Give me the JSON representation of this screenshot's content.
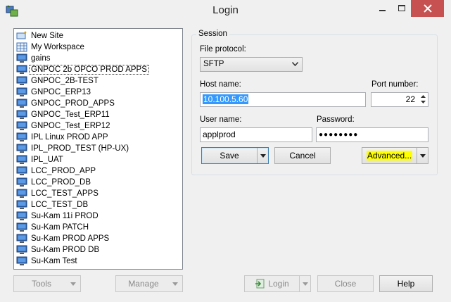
{
  "window": {
    "title": "Login"
  },
  "sites": [
    {
      "label": "New Site",
      "icon": "new-site-icon"
    },
    {
      "label": "My Workspace",
      "icon": "workspace-icon"
    },
    {
      "label": "gains",
      "icon": "computer-icon"
    },
    {
      "label": "GNPOC 2b OPCO PROD APPS",
      "icon": "computer-icon",
      "selected": true
    },
    {
      "label": "GNPOC_2B-TEST",
      "icon": "computer-icon"
    },
    {
      "label": "GNPOC_ERP13",
      "icon": "computer-icon"
    },
    {
      "label": "GNPOC_PROD_APPS",
      "icon": "computer-icon"
    },
    {
      "label": "GNPOC_Test_ERP11",
      "icon": "computer-icon"
    },
    {
      "label": "GNPOC_Test_ERP12",
      "icon": "computer-icon"
    },
    {
      "label": "IPL Linux PROD APP",
      "icon": "computer-icon"
    },
    {
      "label": "IPL_PROD_TEST (HP-UX)",
      "icon": "computer-icon"
    },
    {
      "label": "IPL_UAT",
      "icon": "computer-icon"
    },
    {
      "label": "LCC_PROD_APP",
      "icon": "computer-icon"
    },
    {
      "label": "LCC_PROD_DB",
      "icon": "computer-icon"
    },
    {
      "label": "LCC_TEST_APPS",
      "icon": "computer-icon"
    },
    {
      "label": "LCC_TEST_DB",
      "icon": "computer-icon"
    },
    {
      "label": "Su-Kam 11i PROD",
      "icon": "computer-icon"
    },
    {
      "label": "Su-Kam PATCH",
      "icon": "computer-icon"
    },
    {
      "label": "Su-Kam PROD APPS",
      "icon": "computer-icon"
    },
    {
      "label": "Su-Kam PROD DB",
      "icon": "computer-icon"
    },
    {
      "label": "Su-Kam Test",
      "icon": "computer-icon"
    }
  ],
  "session": {
    "legend": "Session",
    "protocol_label": "File protocol:",
    "protocol_value": "SFTP",
    "host_label": "Host name:",
    "host_value": "10.100.5.60",
    "port_label": "Port number:",
    "port_value": "22",
    "user_label": "User name:",
    "user_value": "applprod",
    "password_label": "Password:",
    "password_mask": "●●●●●●●●",
    "save_label": "Save",
    "cancel_label": "Cancel",
    "advanced_label": "Advanced..."
  },
  "bottom": {
    "tools_label": "Tools",
    "manage_label": "Manage",
    "login_label": "Login",
    "close_label": "Close",
    "help_label": "Help"
  },
  "colors": {
    "selection": "#3399ff",
    "highlight": "#ffff00",
    "close_button": "#c75050"
  }
}
